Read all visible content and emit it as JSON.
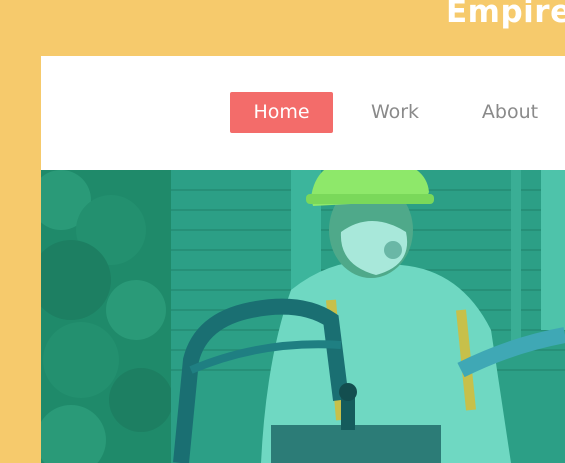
{
  "site": {
    "brand": "Empire"
  },
  "nav": {
    "items": [
      {
        "label": "Home",
        "active": true
      },
      {
        "label": "Work",
        "active": false
      },
      {
        "label": "About",
        "active": false
      }
    ]
  },
  "hero": {
    "image_subject": "worker-in-hard-hat-on-lift",
    "overlay_color": "#2fb39a"
  },
  "colors": {
    "background": "#f6ca6c",
    "accent": "#f36c6a",
    "card": "#ffffff",
    "nav_text": "#8a8a8a"
  }
}
